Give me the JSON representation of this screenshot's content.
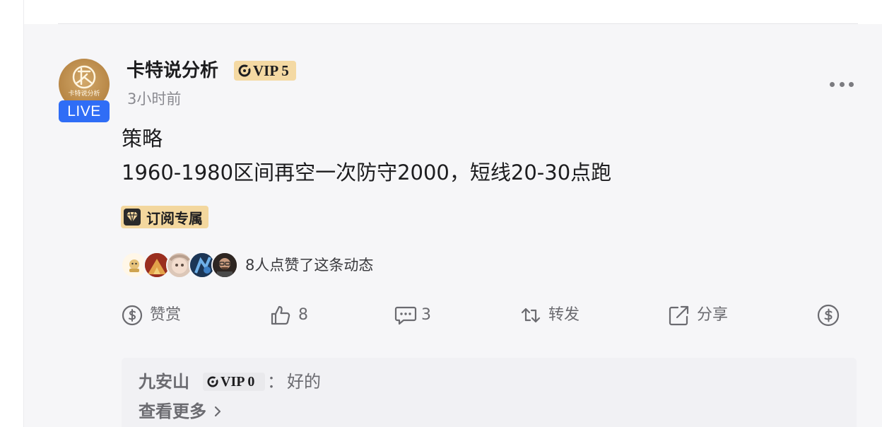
{
  "author": {
    "name": "卡特说分析",
    "vip_label": "VIP 5",
    "avatar_caption": "卡特说分析",
    "live_label": "LIVE",
    "time": "3小时前"
  },
  "post": {
    "title": "策略",
    "body": "1960-1980区间再空一次防守2000，短线20-30点跑",
    "subscription_label": "订阅专属"
  },
  "likes": {
    "text": "8人点赞了这条动态",
    "avatar_count_shown": 5
  },
  "actions": {
    "reward_label": "赞赏",
    "like_count": "8",
    "comment_count": "3",
    "repost_label": "转发",
    "share_label": "分享"
  },
  "comments": [
    {
      "author": "九安山",
      "vip_label": "VIP 0",
      "colon": "：",
      "text": "好的"
    }
  ],
  "see_more_label": "查看更多",
  "icons": {
    "more": "more-dots-icon",
    "reward": "reward-coin-icon",
    "like": "thumbs-up-icon",
    "comment": "comment-bubble-icon",
    "repost": "repost-arrows-icon",
    "share": "share-arrow-icon",
    "tip": "dollar-coin-icon",
    "subscription": "diamond-icon",
    "vip": "vip-crescent-icon",
    "chevron": "chevron-right-icon"
  },
  "colors": {
    "live_badge": "#2f6df6",
    "vip_gold": "#f4d9a3",
    "card_background": "#f6f6f8",
    "muted_text": "#6b6b70"
  }
}
